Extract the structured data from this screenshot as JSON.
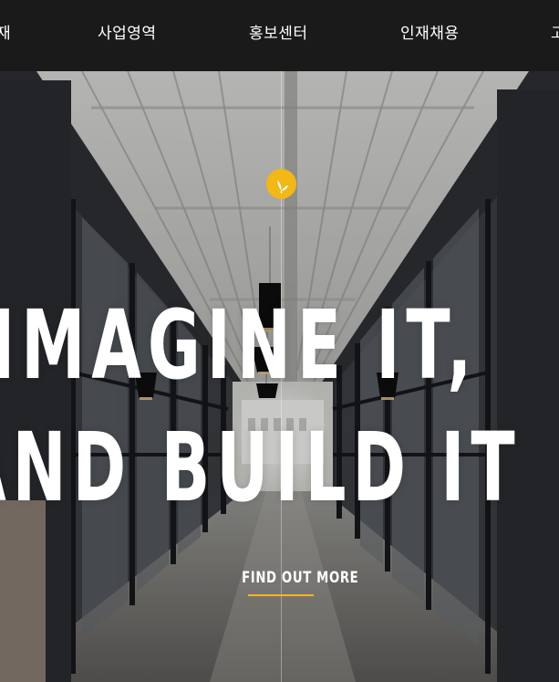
{
  "nav": {
    "partial_left": "재",
    "items": [
      {
        "label": "사업영역"
      },
      {
        "label": "홍보센터"
      },
      {
        "label": "인재채용"
      }
    ],
    "partial_right": "고"
  },
  "hero": {
    "headline_line1": "IMAGINE IT,",
    "headline_line2": "AND BUILD IT",
    "cta_label": "FIND OUT MORE",
    "logo_icon": "sprout-logo-icon"
  },
  "colors": {
    "accent": "#f3b716",
    "nav_background": "#1a1a1a",
    "text": "#ffffff"
  }
}
